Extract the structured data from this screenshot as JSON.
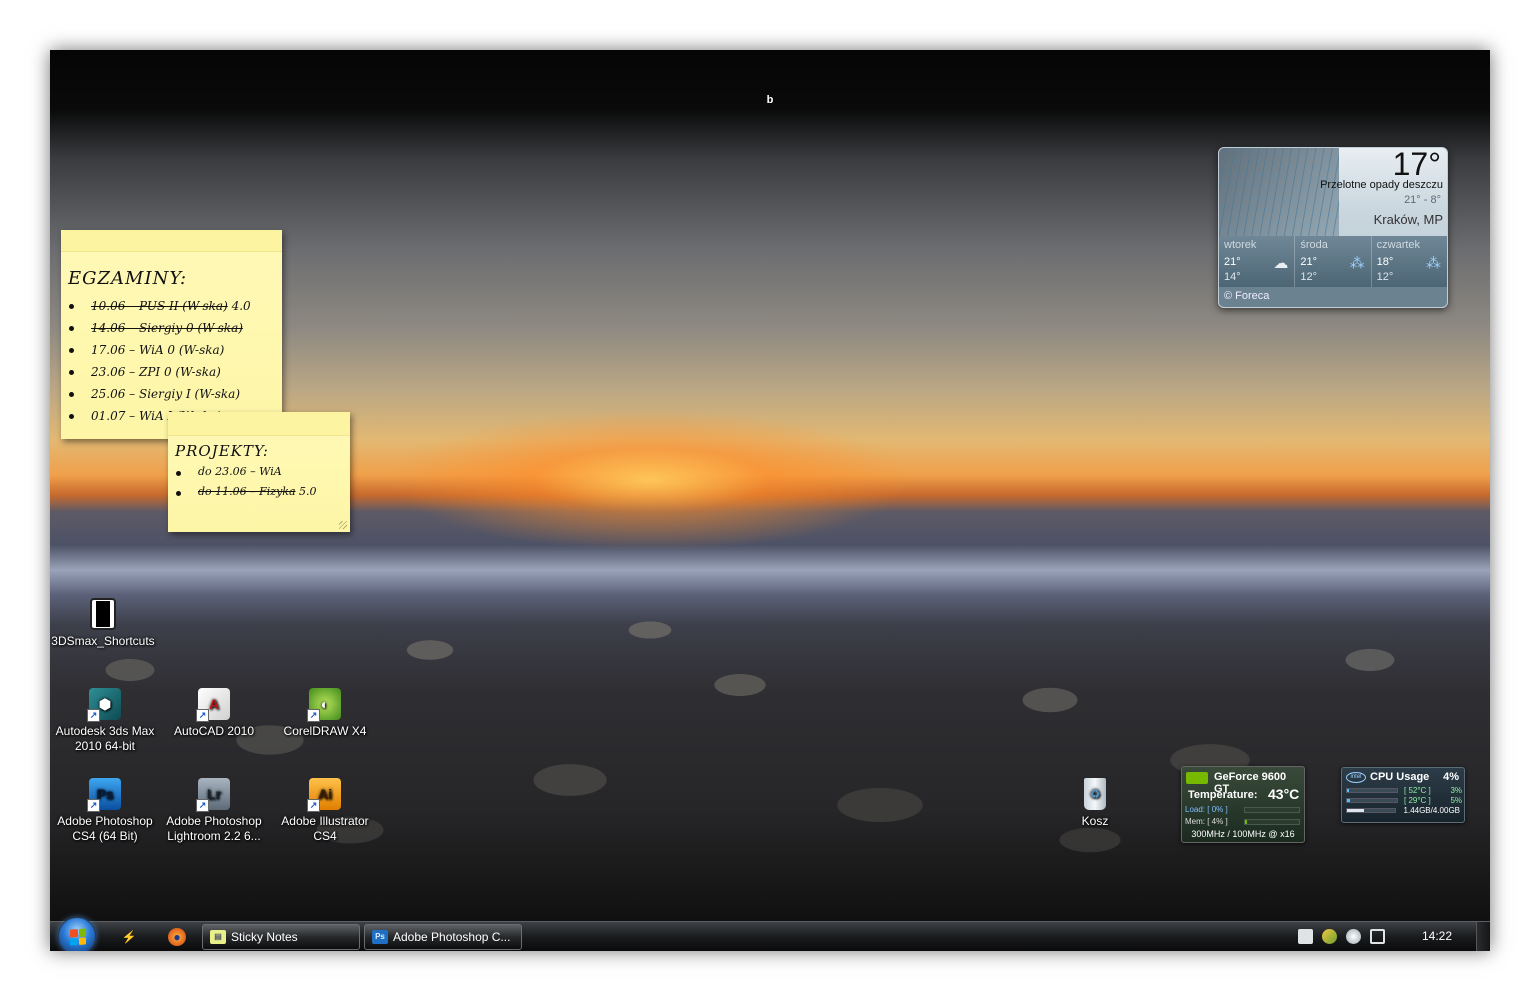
{
  "desktop": {
    "top_title": "b",
    "icons": [
      {
        "label": "3DSmax_Shortcuts",
        "icon": "text-file-icon"
      },
      {
        "label": "Autodesk 3ds Max 2010 64-bit",
        "icon": "3dsmax-icon"
      },
      {
        "label": "AutoCAD 2010",
        "icon": "autocad-icon"
      },
      {
        "label": "CorelDRAW X4",
        "icon": "coreldraw-icon"
      },
      {
        "label": "Adobe Photoshop CS4 (64 Bit)",
        "icon": "photoshop-icon",
        "glyph": "Ps"
      },
      {
        "label": "Adobe Photoshop Lightroom 2.2 6...",
        "icon": "lightroom-icon",
        "glyph": "Lr"
      },
      {
        "label": "Adobe Illustrator CS4",
        "icon": "illustrator-icon",
        "glyph": "Ai"
      },
      {
        "label": "Kosz",
        "icon": "recycle-bin-icon"
      }
    ]
  },
  "sticky_egzaminy": {
    "title": "EGZAMINY:",
    "items": [
      {
        "struck": "10.06 – PUS II (W-ska)",
        "rest": " 4.0"
      },
      {
        "struck": "14.06 – Siergiy 0 (W-ska)",
        "rest": ""
      },
      {
        "struck": "",
        "rest": "17.06 – WiA 0 (W-ska)"
      },
      {
        "struck": "",
        "rest": "23.06 – ZPI 0 (W-ska)"
      },
      {
        "struck": "",
        "rest": "25.06 – Siergiy I (W-ska)"
      },
      {
        "struck": "",
        "rest": "01.07 – WiA I (W-ska)"
      }
    ]
  },
  "sticky_projekty": {
    "title": "PROJEKTY:",
    "items": [
      {
        "struck": "",
        "rest": "do 23.06 – WiA"
      },
      {
        "struck": "do 11.06 – Fizyka",
        "rest": " 5.0"
      }
    ]
  },
  "weather": {
    "temperature": "17°",
    "condition": "Przelotne opady deszczu",
    "range": "21° - 8°",
    "city": "Kraków, MP",
    "forecast": [
      {
        "day": "wtorek",
        "high": "21°",
        "low": "14°",
        "icon": "cloud-icon"
      },
      {
        "day": "środa",
        "high": "21°",
        "low": "12°",
        "icon": "rain-icon"
      },
      {
        "day": "czwartek",
        "high": "18°",
        "low": "12°",
        "icon": "rain-icon"
      }
    ],
    "provider": "© Foreca",
    "colors": {
      "panel": "#c9d6de",
      "strip": "#5a7282"
    }
  },
  "gpu": {
    "name": "GeForce 9600 GT",
    "temp_label": "Temperature:",
    "temp_value": "43°C",
    "load": "Load: [ 0% ]",
    "mem": "Mem: [ 4% ]",
    "clock": "300MHz / 100MHz @ x16",
    "load_fraction": 0.0,
    "mem_fraction": 0.04
  },
  "cpu": {
    "title": "CPU Usage",
    "total": "4%",
    "cores": [
      {
        "temp": "[ 52°C ]",
        "usage": "3%",
        "fraction": 0.03
      },
      {
        "temp": "[ 29°C ]",
        "usage": "5%",
        "fraction": 0.05
      }
    ],
    "ram": "1.44GB/4.00GB",
    "ram_fraction": 0.36
  },
  "taskbar": {
    "tasks": [
      {
        "label": "Sticky Notes",
        "icon": "sticky-notes-icon"
      },
      {
        "label": "Adobe Photoshop C...",
        "icon": "photoshop-icon",
        "glyph": "Ps"
      }
    ],
    "clock": "14:22",
    "accent": "#2a7ad6"
  }
}
